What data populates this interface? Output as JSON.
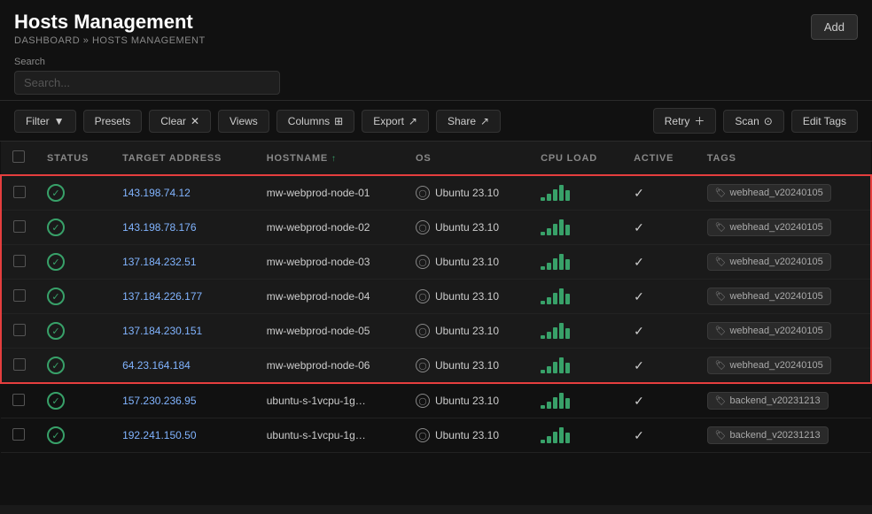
{
  "header": {
    "title": "Hosts Management",
    "breadcrumb_home": "DASHBOARD",
    "breadcrumb_sep": "»",
    "breadcrumb_current": "HOSTS MANAGEMENT",
    "add_button": "Add"
  },
  "search": {
    "label": "Search",
    "placeholder": "Search..."
  },
  "toolbar": {
    "filter_label": "Filter",
    "presets_label": "Presets",
    "clear_label": "Clear",
    "views_label": "Views",
    "columns_label": "Columns",
    "export_label": "Export",
    "share_label": "Share",
    "retry_label": "Retry",
    "scan_label": "Scan",
    "edit_tags_label": "Edit Tags"
  },
  "table": {
    "columns": [
      "",
      "STATUS",
      "TARGET ADDRESS",
      "HOSTNAME ↑",
      "OS",
      "CPU LOAD",
      "ACTIVE",
      "TAGS"
    ],
    "rows": [
      {
        "id": 1,
        "status": "active",
        "ip": "143.198.74.12",
        "hostname": "mw-webprod-node-01",
        "os": "Ubuntu 23.10",
        "cpu_bars": [
          3,
          5,
          7,
          9,
          6
        ],
        "active": true,
        "tag": "webhead_v20240105",
        "highlighted": true
      },
      {
        "id": 2,
        "status": "active",
        "ip": "143.198.78.176",
        "hostname": "mw-webprod-node-02",
        "os": "Ubuntu 23.10",
        "cpu_bars": [
          3,
          5,
          7,
          9,
          6
        ],
        "active": true,
        "tag": "webhead_v20240105",
        "highlighted": true
      },
      {
        "id": 3,
        "status": "active",
        "ip": "137.184.232.51",
        "hostname": "mw-webprod-node-03",
        "os": "Ubuntu 23.10",
        "cpu_bars": [
          3,
          5,
          7,
          9,
          6
        ],
        "active": true,
        "tag": "webhead_v20240105",
        "highlighted": true
      },
      {
        "id": 4,
        "status": "active",
        "ip": "137.184.226.177",
        "hostname": "mw-webprod-node-04",
        "os": "Ubuntu 23.10",
        "cpu_bars": [
          3,
          5,
          7,
          9,
          6
        ],
        "active": true,
        "tag": "webhead_v20240105",
        "highlighted": true
      },
      {
        "id": 5,
        "status": "active",
        "ip": "137.184.230.151",
        "hostname": "mw-webprod-node-05",
        "os": "Ubuntu 23.10",
        "cpu_bars": [
          3,
          5,
          7,
          9,
          6
        ],
        "active": true,
        "tag": "webhead_v20240105",
        "highlighted": true
      },
      {
        "id": 6,
        "status": "active",
        "ip": "64.23.164.184",
        "hostname": "mw-webprod-node-06",
        "os": "Ubuntu 23.10",
        "cpu_bars": [
          3,
          5,
          7,
          9,
          6
        ],
        "active": true,
        "tag": "webhead_v20240105",
        "highlighted": true
      },
      {
        "id": 7,
        "status": "active",
        "ip": "157.230.236.95",
        "hostname": "ubuntu-s-1vcpu-1g…",
        "os": "Ubuntu 23.10",
        "cpu_bars": [
          3,
          5,
          7,
          9,
          6
        ],
        "active": true,
        "tag": "backend_v20231213",
        "highlighted": false
      },
      {
        "id": 8,
        "status": "active",
        "ip": "192.241.150.50",
        "hostname": "ubuntu-s-1vcpu-1g…",
        "os": "Ubuntu 23.10",
        "cpu_bars": [
          3,
          5,
          7,
          9,
          6
        ],
        "active": true,
        "tag": "backend_v20231213",
        "highlighted": false
      }
    ]
  },
  "colors": {
    "accent_green": "#38a169",
    "accent_red": "#e53e3e",
    "highlight_blue": "#81b4ff",
    "bg_dark": "#111",
    "bg_medium": "#1a1a1a",
    "border": "#333"
  }
}
